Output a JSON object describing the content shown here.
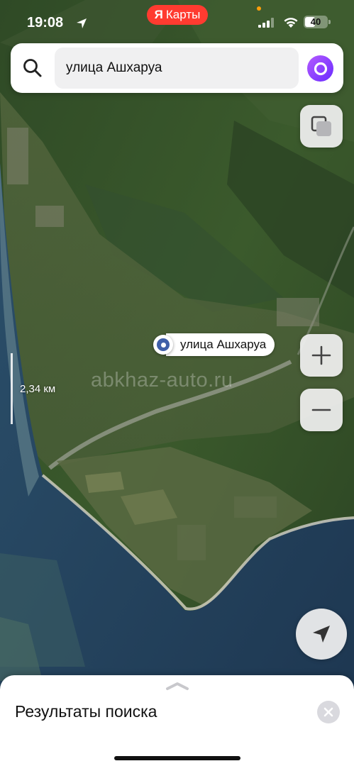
{
  "status_bar": {
    "time": "19:08",
    "battery": "40"
  },
  "app_pill": {
    "logo_letter": "Я",
    "name": "Карты"
  },
  "search": {
    "query": "улица Ашхаруа"
  },
  "map": {
    "pin_label": "улица Ашхаруа",
    "scale_label": "2,34 км",
    "watermark": "abkhaz-auto.ru"
  },
  "sheet": {
    "title": "Результаты поиска"
  },
  "icons": {
    "search": "search-icon",
    "assistant": "alice-icon",
    "layers": "layers-icon",
    "zoom_in": "plus-icon",
    "zoom_out": "minus-icon",
    "locate": "navigation-arrow-icon",
    "close": "close-icon",
    "grabber": "chevron-up-icon"
  },
  "colors": {
    "app_pill": "#ff3b30",
    "pin": "#3f5fa8",
    "assistant": "#8a3dff"
  }
}
